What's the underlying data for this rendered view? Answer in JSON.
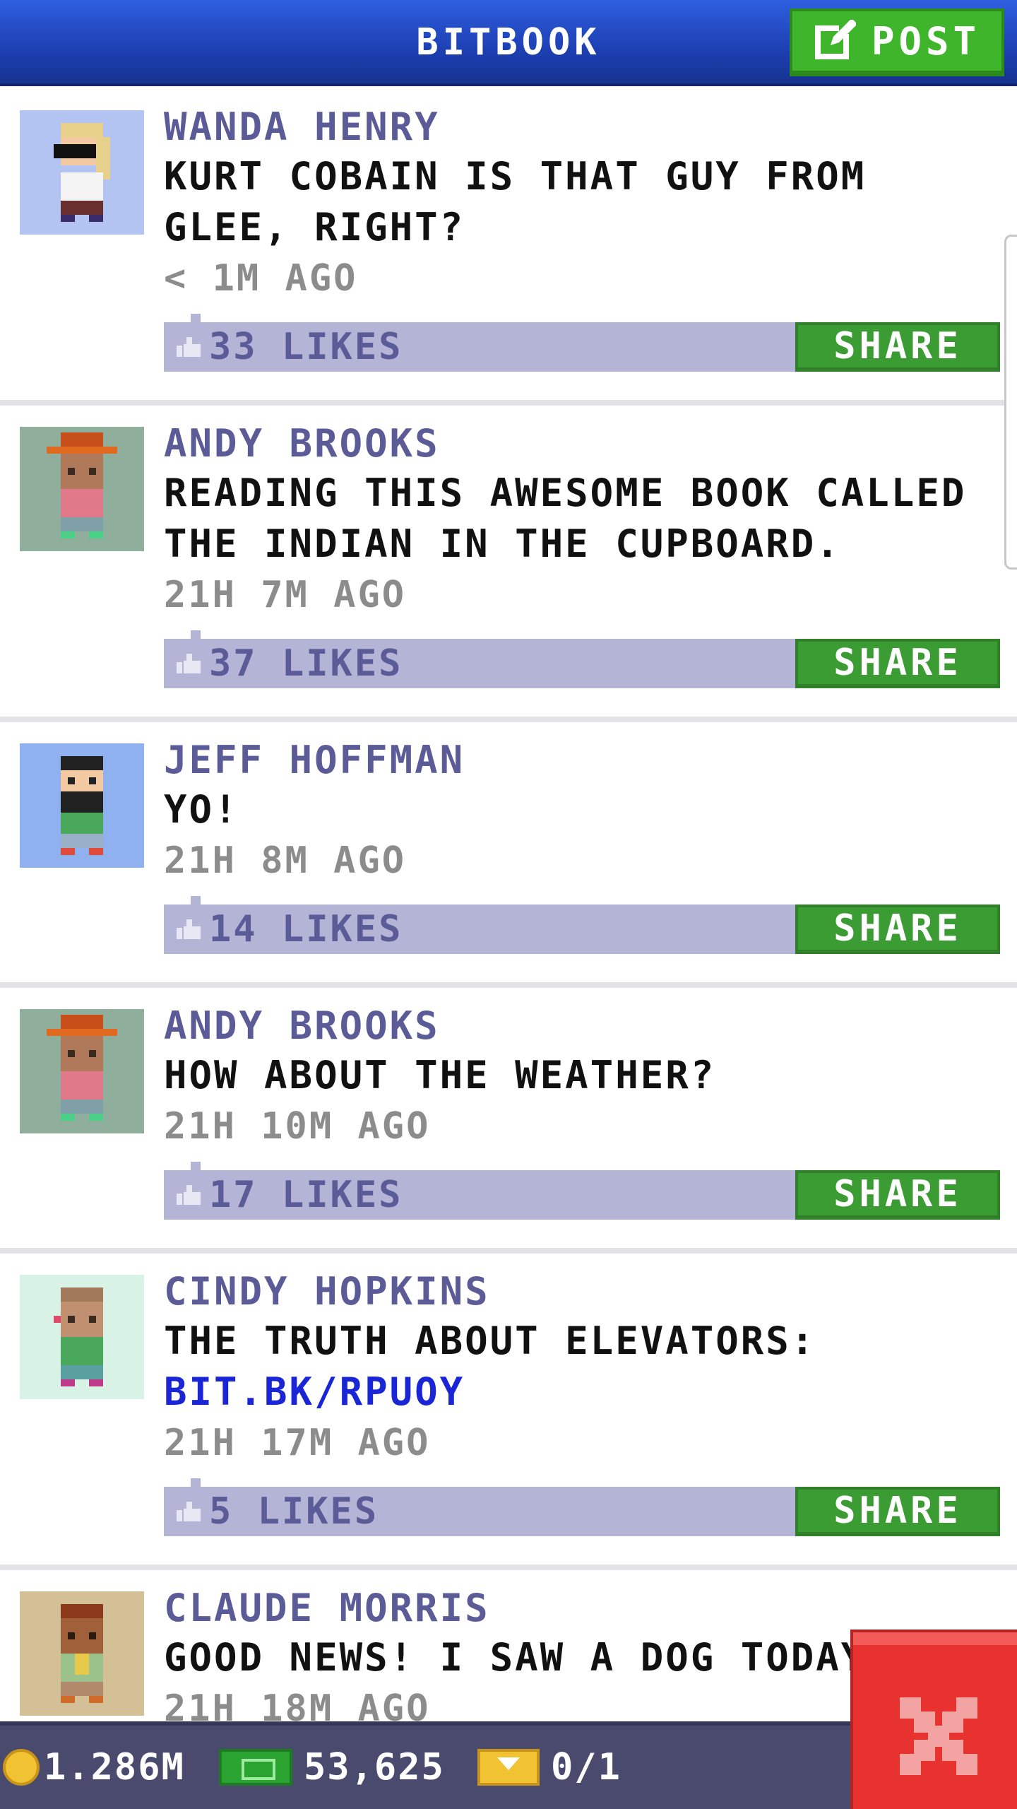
{
  "header": {
    "title": "BITBOOK",
    "post_label": "POST"
  },
  "feed": [
    {
      "author": "WANDA HENRY",
      "text": "KURT COBAIN IS THAT GUY FROM GLEE, RIGHT?",
      "link": "",
      "time": "< 1M AGO",
      "likes": "33 LIKES",
      "share": "SHARE",
      "avatar_bg": "#b3c4f3"
    },
    {
      "author": "ANDY BROOKS",
      "text": "READING THIS AWESOME BOOK CALLED THE INDIAN IN THE CUPBOARD.",
      "link": "",
      "time": "21H 7M AGO",
      "likes": "37 LIKES",
      "share": "SHARE",
      "avatar_bg": "#8fae9c"
    },
    {
      "author": "JEFF HOFFMAN",
      "text": "YO!",
      "link": "",
      "time": "21H 8M AGO",
      "likes": "14 LIKES",
      "share": "SHARE",
      "avatar_bg": "#8fb1ef"
    },
    {
      "author": "ANDY BROOKS",
      "text": "HOW ABOUT THE WEATHER?",
      "link": "",
      "time": "21H 10M AGO",
      "likes": "17 LIKES",
      "share": "SHARE",
      "avatar_bg": "#8fae9c"
    },
    {
      "author": "CINDY HOPKINS",
      "text": "THE TRUTH ABOUT ELEVATORS:",
      "link": "BIT.BK/RPUOY",
      "time": "21H 17M AGO",
      "likes": "5 LIKES",
      "share": "SHARE",
      "avatar_bg": "#d8f3e6"
    },
    {
      "author": "CLAUDE MORRIS",
      "text": "GOOD NEWS! I SAW A DOG TODAY!",
      "link": "",
      "time": "21H 18M AGO",
      "likes": "",
      "share": "",
      "avatar_bg": "#d3c096"
    }
  ],
  "footer": {
    "coins": "1.286M",
    "cash": "53,625",
    "bux": "0/1"
  },
  "colors": {
    "header_blue": "#1d3fb3",
    "post_green": "#3fb52c",
    "share_green": "#3a9c32",
    "like_bar": "#b4b4d6",
    "author_purple": "#5b5b98",
    "link_blue": "#1a26d6",
    "close_red": "#e8322f",
    "footer_bg": "#4a4a6e"
  }
}
